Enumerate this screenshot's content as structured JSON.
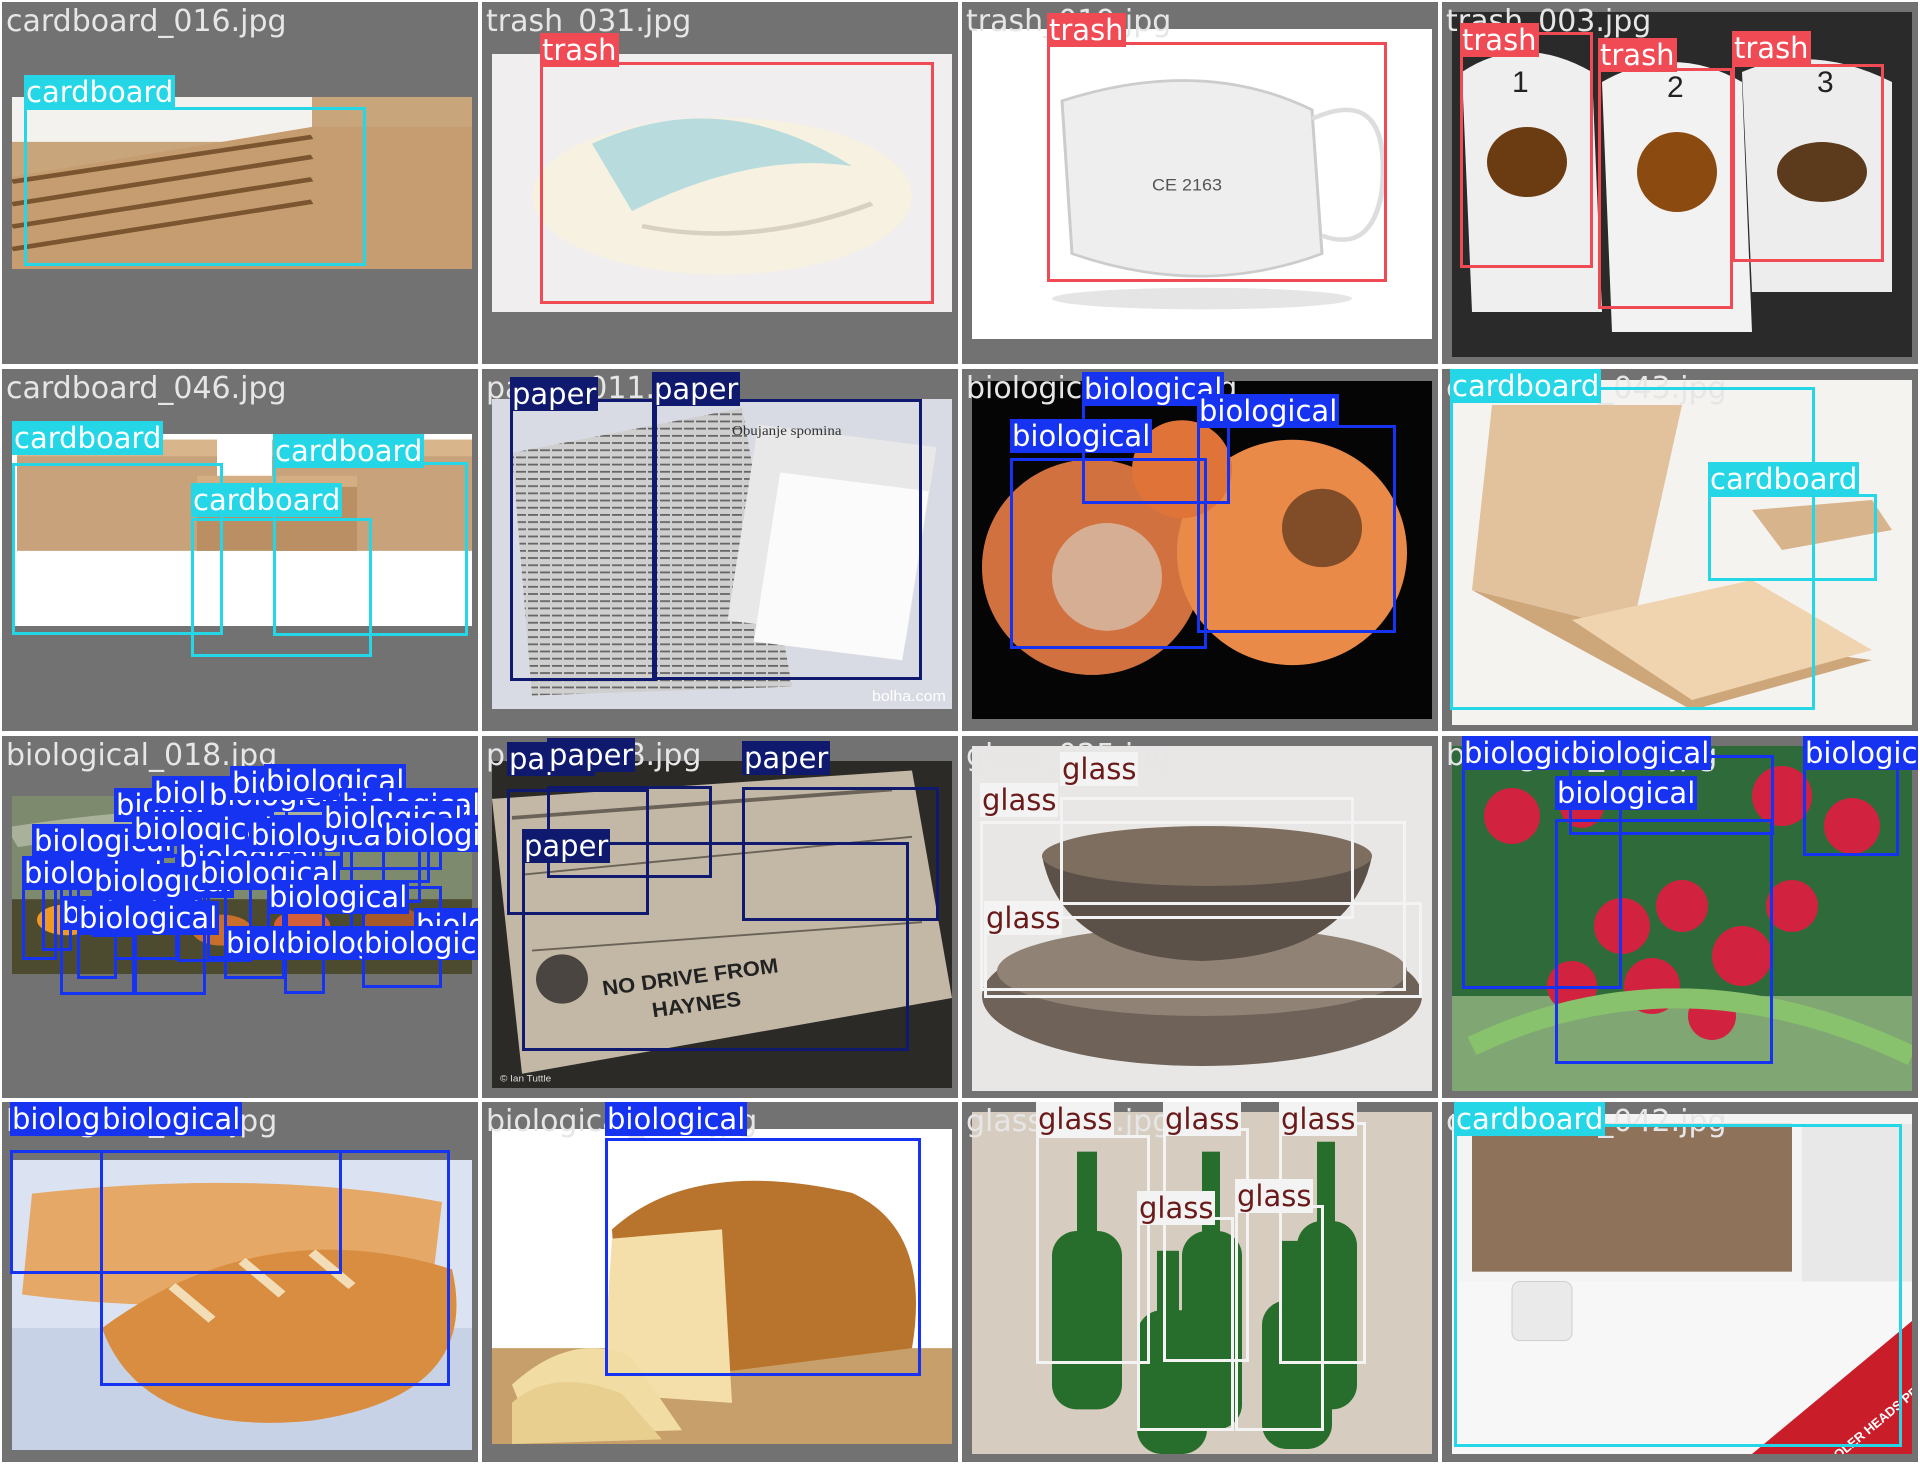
{
  "colors": {
    "background": "#727272",
    "filename_text": "#e6e6e6",
    "cardboard": "#24d6e6",
    "trash": "#f04a55",
    "paper": "#0f1a6e",
    "biological": "#1533f0",
    "glass": "#f3f3f3",
    "glass_text": "#6b1a1a"
  },
  "tiles": [
    {
      "filename": "cardboard_016.jpg",
      "photo": "cardboard-sheets",
      "detections": [
        {
          "label": "cardboard",
          "cls": "cardboard"
        }
      ]
    },
    {
      "filename": "trash_031.jpg",
      "photo": "wrapped-diaper",
      "detections": [
        {
          "label": "trash",
          "cls": "trash"
        }
      ]
    },
    {
      "filename": "trash_019.jpg",
      "photo": "face-mask",
      "caption": "CE 2163",
      "detections": [
        {
          "label": "trash",
          "cls": "trash"
        }
      ]
    },
    {
      "filename": "trash_003.jpg",
      "photo": "used-tissues",
      "marks": [
        "1",
        "2",
        "3"
      ],
      "detections": [
        {
          "label": "trash",
          "cls": "trash"
        },
        {
          "label": "trash",
          "cls": "trash"
        },
        {
          "label": "trash",
          "cls": "trash"
        }
      ]
    },
    {
      "filename": "cardboard_046.jpg",
      "photo": "cardboard-boxes",
      "detections": [
        {
          "label": "cardboard",
          "cls": "cardboard"
        },
        {
          "label": "cardboard",
          "cls": "cardboard"
        },
        {
          "label": "cardboard",
          "cls": "cardboard"
        }
      ]
    },
    {
      "filename": "paper_011.jpg",
      "photo": "newspapers",
      "watermark": "bolha.com",
      "headline": "Obujanje spomina",
      "detections": [
        {
          "label": "paper",
          "cls": "paper"
        },
        {
          "label": "paper",
          "cls": "paper"
        }
      ]
    },
    {
      "filename": "biological_024.jpg",
      "photo": "rotten-peaches",
      "detections": [
        {
          "label": "biological",
          "cls": "biological"
        },
        {
          "label": "biological",
          "cls": "biological"
        },
        {
          "label": "biological",
          "cls": "biological"
        }
      ]
    },
    {
      "filename": "cardboard_043.jpg",
      "photo": "open-box",
      "detections": [
        {
          "label": "cardboard",
          "cls": "cardboard"
        },
        {
          "label": "cardboard",
          "cls": "cardboard"
        }
      ]
    },
    {
      "filename": "biological_018.jpg",
      "photo": "food-scraps",
      "detections": [
        {
          "label": "biological",
          "cls": "biological"
        },
        {
          "label": "biological",
          "cls": "biological"
        },
        {
          "label": "biological",
          "cls": "biological"
        },
        {
          "label": "biological",
          "cls": "biological"
        },
        {
          "label": "biological",
          "cls": "biological"
        },
        {
          "label": "biological",
          "cls": "biological"
        },
        {
          "label": "biological",
          "cls": "biological"
        },
        {
          "label": "biological",
          "cls": "biological"
        },
        {
          "label": "biological",
          "cls": "biological"
        },
        {
          "label": "biological",
          "cls": "biological"
        },
        {
          "label": "biological",
          "cls": "biological"
        },
        {
          "label": "biological",
          "cls": "biological"
        },
        {
          "label": "biological",
          "cls": "biological"
        },
        {
          "label": "biological",
          "cls": "biological"
        },
        {
          "label": "biological",
          "cls": "biological"
        },
        {
          "label": "biological",
          "cls": "biological"
        },
        {
          "label": "biological",
          "cls": "biological"
        },
        {
          "label": "biological",
          "cls": "biological"
        },
        {
          "label": "biological",
          "cls": "biological"
        },
        {
          "label": "biological",
          "cls": "biological"
        },
        {
          "label": "biological",
          "cls": "biological"
        },
        {
          "label": "biological",
          "cls": "biological"
        }
      ]
    },
    {
      "filename": "paper_008.jpg",
      "photo": "old-newspapers",
      "headline": "NO DRIVE FROM HAYNES",
      "credit": "© Ian Tuttle",
      "detections": [
        {
          "label": "paper",
          "cls": "paper"
        },
        {
          "label": "paper",
          "cls": "paper"
        },
        {
          "label": "paper",
          "cls": "paper"
        },
        {
          "label": "paper",
          "cls": "paper"
        }
      ]
    },
    {
      "filename": "glass_025.jpg",
      "photo": "glass-bowls",
      "detections": [
        {
          "label": "glass",
          "cls": "glass"
        },
        {
          "label": "glass",
          "cls": "glass"
        },
        {
          "label": "glass",
          "cls": "glass"
        }
      ]
    },
    {
      "filename": "biological_030.jpg",
      "photo": "radishes",
      "detections": [
        {
          "label": "biological",
          "cls": "biological"
        },
        {
          "label": "biological",
          "cls": "biological"
        },
        {
          "label": "biological",
          "cls": "biological"
        },
        {
          "label": "biological",
          "cls": "biological"
        }
      ]
    },
    {
      "filename": "biological_025.jpg",
      "photo": "baguette",
      "detections": [
        {
          "label": "biological",
          "cls": "biological"
        },
        {
          "label": "biological",
          "cls": "biological"
        }
      ]
    },
    {
      "filename": "biological_031.jpg",
      "photo": "bread-loaf",
      "detections": [
        {
          "label": "biological",
          "cls": "biological"
        }
      ]
    },
    {
      "filename": "glass_011.jpg",
      "photo": "green-bottles",
      "detections": [
        {
          "label": "glass",
          "cls": "glass"
        },
        {
          "label": "glass",
          "cls": "glass"
        },
        {
          "label": "glass",
          "cls": "glass"
        },
        {
          "label": "glass",
          "cls": "glass"
        },
        {
          "label": "glass",
          "cls": "glass"
        }
      ]
    },
    {
      "filename": "cardboard_042.jpg",
      "photo": "printed-box",
      "caption": "COOLER HEADS PREVAIL",
      "detections": [
        {
          "label": "cardboard",
          "cls": "cardboard"
        }
      ]
    }
  ]
}
